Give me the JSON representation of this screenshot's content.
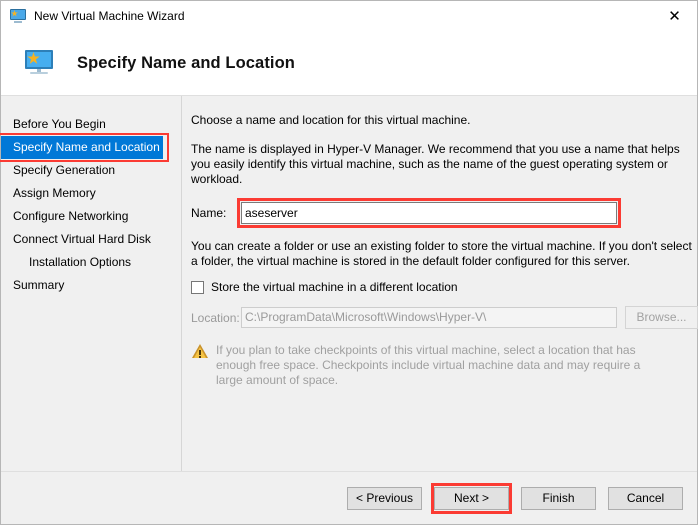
{
  "window": {
    "title": "New Virtual Machine Wizard",
    "title_icon": "virtual-machine-icon",
    "close_label": "✕"
  },
  "banner": {
    "icon": "virtual-machine-icon",
    "title": "Specify Name and Location"
  },
  "sidebar": {
    "items": [
      {
        "label": "Before You Begin",
        "selected": false,
        "indent": false
      },
      {
        "label": "Specify Name and Location",
        "selected": true,
        "indent": false
      },
      {
        "label": "Specify Generation",
        "selected": false,
        "indent": false
      },
      {
        "label": "Assign Memory",
        "selected": false,
        "indent": false
      },
      {
        "label": "Configure Networking",
        "selected": false,
        "indent": false
      },
      {
        "label": "Connect Virtual Hard Disk",
        "selected": false,
        "indent": false
      },
      {
        "label": "Installation Options",
        "selected": false,
        "indent": true
      },
      {
        "label": "Summary",
        "selected": false,
        "indent": false
      }
    ]
  },
  "main": {
    "intro": "Choose a name and location for this virtual machine.",
    "description": "The name is displayed in Hyper-V Manager. We recommend that you use a name that helps you easily identify this virtual machine, such as the name of the guest operating system or workload.",
    "name_label": "Name:",
    "name_value": "aseserver",
    "name_placeholder": "",
    "folder_description": "You can create a folder or use an existing folder to store the virtual machine. If you don't select a folder, the virtual machine is stored in the default folder configured for this server.",
    "store_checkbox_label": "Store the virtual machine in a different location",
    "store_checkbox_checked": false,
    "location_label": "Location:",
    "location_value": "C:\\ProgramData\\Microsoft\\Windows\\Hyper-V\\",
    "browse_label": "Browse...",
    "warning_icon": "warning-triangle-icon",
    "warning_text": "If you plan to take checkpoints of this virtual machine, select a location that has enough free space. Checkpoints include virtual machine data and may require a large amount of space."
  },
  "footer": {
    "previous_label": "< Previous",
    "next_label": "Next >",
    "finish_label": "Finish",
    "cancel_label": "Cancel"
  },
  "highlights": {
    "color": "#fb3b33",
    "targets": [
      "sidebar-selected-item",
      "name-input",
      "next-button"
    ]
  },
  "colors": {
    "selection_blue": "#0078d7",
    "window_background": "#f0f0f0",
    "highlight_red": "#fb3b33",
    "disabled_text": "#9a9a9a",
    "warning_amber": "#f5c344"
  }
}
